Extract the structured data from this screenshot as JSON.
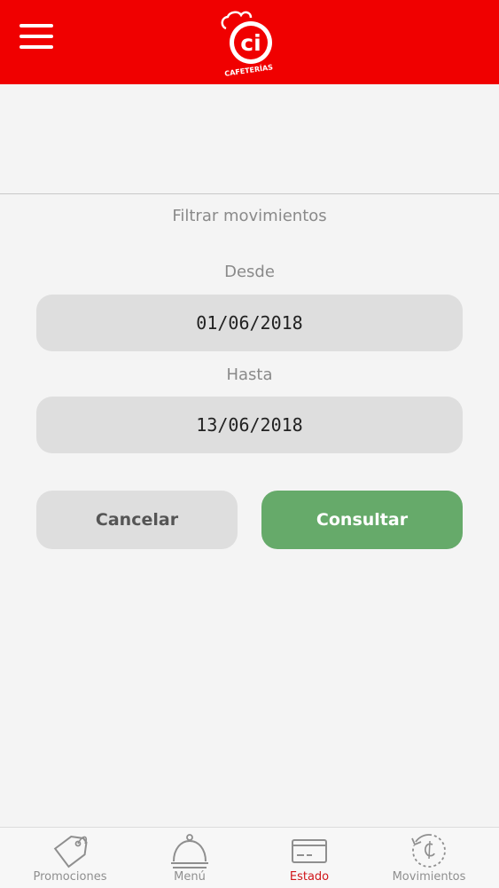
{
  "header": {
    "logo_text": "ci",
    "logo_subtitle": "CAFETERÍAS",
    "brand_color": "#f00000"
  },
  "filter": {
    "title": "Filtrar movimientos",
    "from_label": "Desde",
    "from_value": "01/06/2018",
    "to_label": "Hasta",
    "to_value": "13/06/2018"
  },
  "actions": {
    "cancel_label": "Cancelar",
    "submit_label": "Consultar",
    "submit_color": "#66aa6a"
  },
  "bottom_nav": {
    "active_index": 2,
    "active_color": "#d0161a",
    "items": [
      {
        "label": "Promociones",
        "icon": "tag-icon"
      },
      {
        "label": "Menú",
        "icon": "cloche-icon"
      },
      {
        "label": "Estado",
        "icon": "credit-card-icon"
      },
      {
        "label": "Movimientos",
        "icon": "history-icon"
      }
    ]
  }
}
